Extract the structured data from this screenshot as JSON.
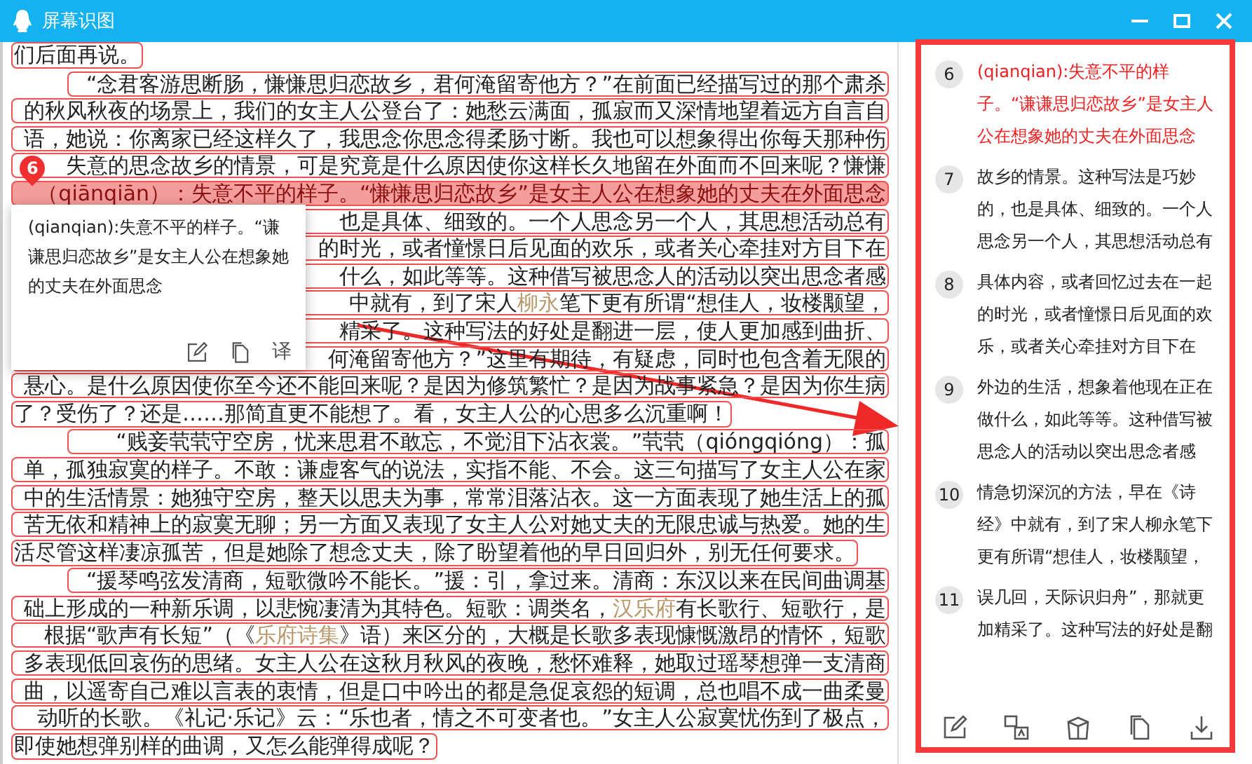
{
  "window": {
    "title": "屏幕识图"
  },
  "document": {
    "lines": [
      {
        "kind": "last",
        "selected": false,
        "parts": [
          {
            "text": "们后面再说。",
            "link": false
          }
        ]
      },
      {
        "kind": "first",
        "selected": false,
        "parts": [
          {
            "text": "“念君客游思断肠，慊慊思归恋故乡，君何淹留寄他方？”在前面已经描写过的那个肃杀",
            "link": false
          }
        ]
      },
      {
        "kind": "body",
        "selected": false,
        "parts": [
          {
            "text": "的秋风秋夜的场景上，我们的女主人公登台了：她愁云满面，孤寂而又深情地望着远方自言自",
            "link": false
          }
        ]
      },
      {
        "kind": "body",
        "selected": false,
        "parts": [
          {
            "text": "语，她说：你离家已经这样久了，我思念你思念得柔肠寸断。我也可以想象得出你每天那种伤",
            "link": false
          }
        ]
      },
      {
        "kind": "body",
        "selected": false,
        "parts": [
          {
            "text": "失意的思念故乡的情景，可是究竟是什么原因使你这样长久地留在外面而不回来呢？慊慊",
            "link": false
          }
        ]
      },
      {
        "kind": "body",
        "selected": true,
        "marker": "6",
        "parts": [
          {
            "text": "（qiānqiān）：失意不平的样子。“慊慊思归恋故乡”是女主人公在想象她的丈夫在外面思念",
            "link": false
          }
        ]
      },
      {
        "kind": "body",
        "selected": false,
        "parts": [
          {
            "text": "也是具体、细致的。一个人思念另一个人，其思想活动总有",
            "link": false
          }
        ]
      },
      {
        "kind": "body",
        "selected": false,
        "parts": [
          {
            "text": "的时光，或者憧憬日后见面的欢乐，或者关心牵挂对方目下在",
            "link": false
          }
        ]
      },
      {
        "kind": "body",
        "selected": false,
        "parts": [
          {
            "text": "什么，如此等等。这种借写被思念人的活动以突出思念者感",
            "link": false
          }
        ]
      },
      {
        "kind": "body",
        "selected": false,
        "parts": [
          {
            "text": "中就有，到了宋人",
            "link": false
          },
          {
            "text": "柳永",
            "link": true
          },
          {
            "text": "笔下更有所谓“想佳人，妆楼颙望，",
            "link": false
          }
        ]
      },
      {
        "kind": "body",
        "selected": false,
        "parts": [
          {
            "text": "精采了。这种写法的好处是翻进一层，使人更加感到曲折、",
            "link": false
          }
        ]
      },
      {
        "kind": "body",
        "selected": false,
        "parts": [
          {
            "text": "何淹留寄他方？”这里有期待，有疑虑，同时也包含着无限的",
            "link": false
          }
        ]
      },
      {
        "kind": "body",
        "selected": false,
        "parts": [
          {
            "text": "悬心。是什么原因使你至今还不能回来呢？是因为修筑繁忙？是因为战事紧急？是因为你生病",
            "link": false
          }
        ]
      },
      {
        "kind": "last",
        "selected": false,
        "parts": [
          {
            "text": "了？受伤了？还是……那简直更不能想了。看，女主人公的心思多么沉重啊！",
            "link": false
          }
        ]
      },
      {
        "kind": "first",
        "selected": false,
        "parts": [
          {
            "text": "“贱妾茕茕守空房，忧来思君不敢忘，不觉泪下沾衣裳。”茕茕（qióngqióng）：孤",
            "link": false
          }
        ]
      },
      {
        "kind": "body",
        "selected": false,
        "parts": [
          {
            "text": "单，孤独寂寞的样子。不敢：谦虚客气的说法，实指不能、不会。这三句描写了女主人公在家",
            "link": false
          }
        ]
      },
      {
        "kind": "body",
        "selected": false,
        "parts": [
          {
            "text": "中的生活情景：她独守空房，整天以思夫为事，常常泪落沾衣。这一方面表现了她生活上的孤",
            "link": false
          }
        ]
      },
      {
        "kind": "body",
        "selected": false,
        "parts": [
          {
            "text": "苦无依和精神上的寂寞无聊；另一方面又表现了女主人公对她丈夫的无限忠诚与热爱。她的生",
            "link": false
          }
        ]
      },
      {
        "kind": "last",
        "selected": false,
        "parts": [
          {
            "text": "活尽管这样凄凉孤苦，但是她除了想念丈夫，除了盼望着他的早日回归外，别无任何要求。",
            "link": false
          }
        ]
      },
      {
        "kind": "first",
        "selected": false,
        "parts": [
          {
            "text": "“援琴鸣弦发清商，短歌微吟不能长。”援：引，拿过来。清商：东汉以来在民间曲调基",
            "link": false
          }
        ]
      },
      {
        "kind": "body",
        "selected": false,
        "parts": [
          {
            "text": "础上形成的一种新乐调，以悲惋凄清为其特色。短歌：调类名，",
            "link": false
          },
          {
            "text": "汉乐府",
            "link": true
          },
          {
            "text": "有长歌行、短歌行，是",
            "link": false
          }
        ]
      },
      {
        "kind": "body",
        "selected": false,
        "parts": [
          {
            "text": "根据“歌声有长短”（《",
            "link": false
          },
          {
            "text": "乐府诗集",
            "link": true
          },
          {
            "text": "》语）来区分的，大概是长歌多表现慷慨激昂的情怀，短歌",
            "link": false
          }
        ]
      },
      {
        "kind": "body",
        "selected": false,
        "parts": [
          {
            "text": "多表现低回哀伤的思绪。女主人公在这秋月秋风的夜晚，愁怀难释，她取过瑶琴想弹一支清商",
            "link": false
          }
        ]
      },
      {
        "kind": "body",
        "selected": false,
        "parts": [
          {
            "text": "曲，以遥寄自己难以言表的衷情，但是口中吟出的都是急促哀怨的短调，总也唱不成一曲柔曼",
            "link": false
          }
        ]
      },
      {
        "kind": "body",
        "selected": false,
        "parts": [
          {
            "text": "动听的长歌。《礼记·乐记》云：“乐也者，情之不可变者也。”女主人公寂寞忧伤到了极点，",
            "link": false
          }
        ]
      },
      {
        "kind": "last",
        "selected": false,
        "parts": [
          {
            "text": "即使她想弹别样的曲调，又怎么能弹得成呢？",
            "link": false
          }
        ]
      }
    ]
  },
  "popup": {
    "text": "(qianqian):失意不平的样子。“谦谦思归恋故乡”是女主人公在想象她的丈夫在外面思念",
    "translate_label": "译"
  },
  "results": [
    {
      "number": "6",
      "selected": true,
      "text": "(qianqian):失意不平的样子。“谦谦思归恋故乡”是女主人公在想象她的丈夫在外面思念"
    },
    {
      "number": "7",
      "selected": false,
      "text": "故乡的情景。这种写法是巧妙的，也是具体、细致的。一个人思念另一个人，其思想活动总有"
    },
    {
      "number": "8",
      "selected": false,
      "text": "具体内容，或者回忆过去在一起的时光，或者憧憬日后见面的欢乐，或者关心牵挂对方目下在"
    },
    {
      "number": "9",
      "selected": false,
      "text": "外边的生活，想象着他现在正在做什么，如此等等。这种借写被思念人的活动以突出思念者感"
    },
    {
      "number": "10",
      "selected": false,
      "text": "情急切深沉的方法，早在《诗经》中就有，到了宋人柳永笔下更有所谓“想佳人，妆楼颙望，"
    },
    {
      "number": "11",
      "selected": false,
      "text": "误几回，天际识归舟”，那就更加精采了。这种写法的好处是翻"
    }
  ]
}
